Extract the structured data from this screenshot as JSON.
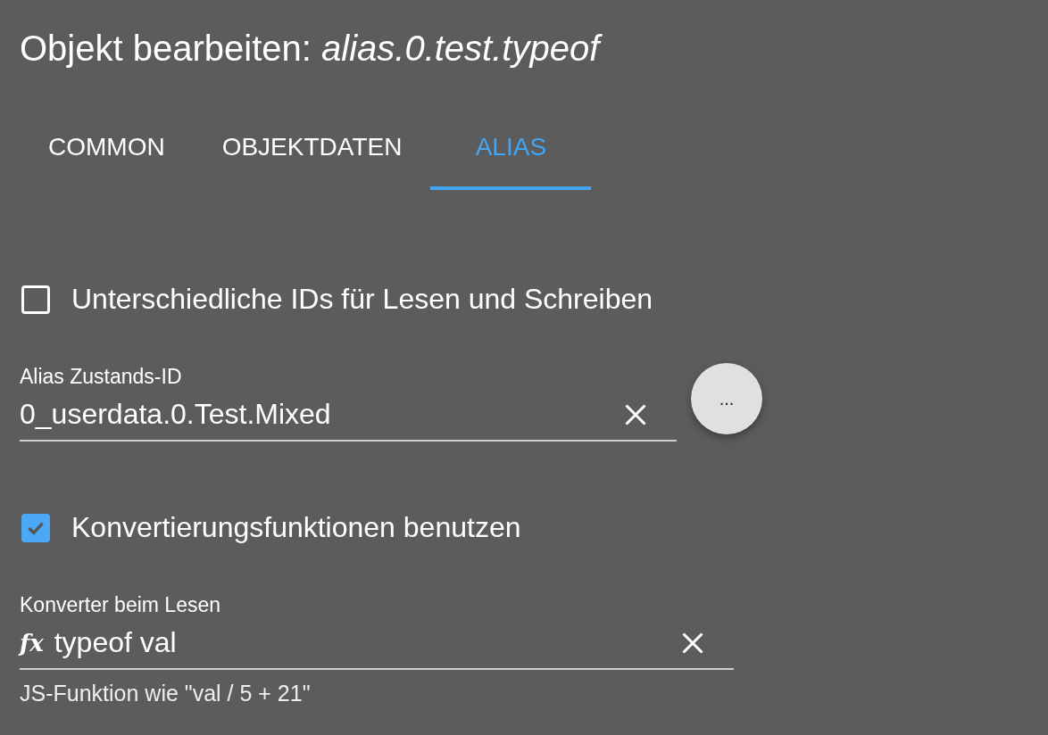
{
  "title": {
    "prefix": "Objekt bearbeiten: ",
    "object_id": "alias.0.test.typeof"
  },
  "tabs": [
    {
      "label": "COMMON",
      "selected": false
    },
    {
      "label": "OBJEKTDATEN",
      "selected": false
    },
    {
      "label": "ALIAS",
      "selected": true
    }
  ],
  "separate_ids": {
    "label": "Unterschiedliche IDs für Lesen und Schreiben",
    "checked": false
  },
  "alias_id": {
    "label": "Alias Zustands-ID",
    "value": "0_userdata.0.Test.Mixed",
    "browse_button": "..."
  },
  "use_converters": {
    "label": "Konvertierungsfunktionen benutzen",
    "checked": true
  },
  "read_converter": {
    "label": "Konverter beim Lesen",
    "prefix": "fx",
    "value": "typeof val",
    "helper": "JS-Funktion wie \"val / 5 + 21\""
  }
}
